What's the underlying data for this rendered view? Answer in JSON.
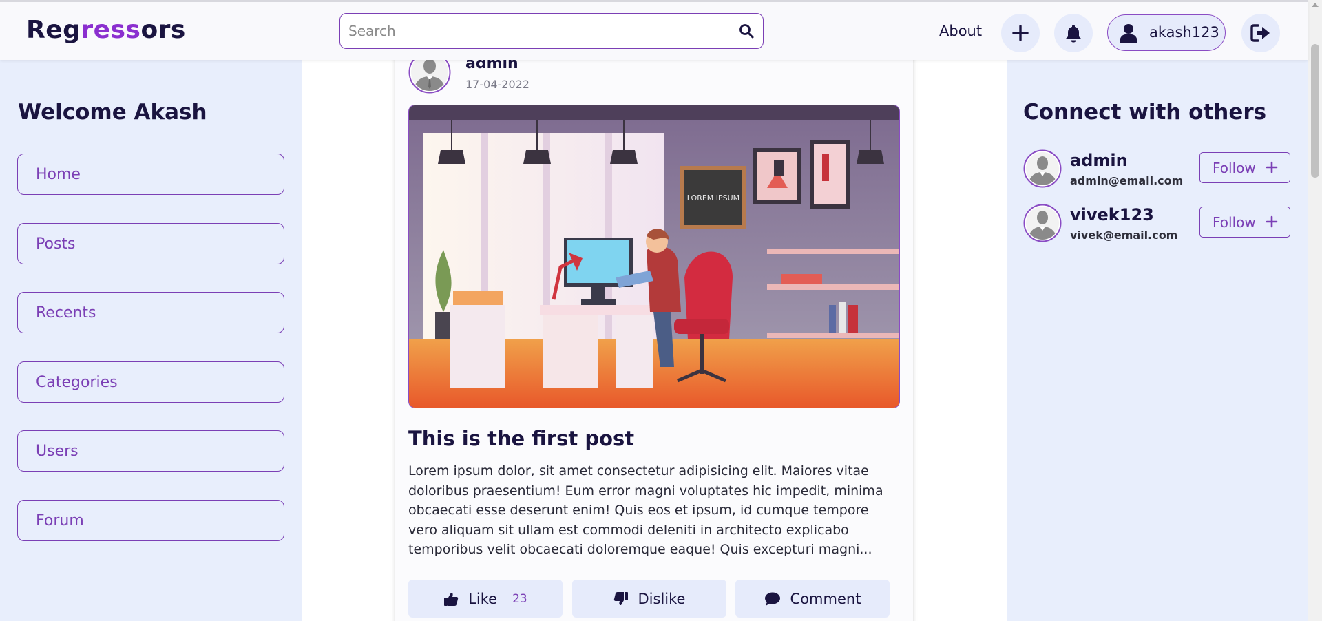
{
  "brand": {
    "part1": "Reg",
    "part2": "ress",
    "part3": "ors",
    "accent_color": "#8b2fcf"
  },
  "search": {
    "placeholder": "Search",
    "value": ""
  },
  "nav": {
    "about_label": "About",
    "add_icon": "plus-icon",
    "notification_icon": "bell-icon",
    "username": "akash123",
    "logout_icon": "sign-out-icon"
  },
  "sidebar": {
    "welcome": "Welcome Akash",
    "items": [
      {
        "label": "Home"
      },
      {
        "label": "Posts"
      },
      {
        "label": "Recents"
      },
      {
        "label": "Categories"
      },
      {
        "label": "Users"
      },
      {
        "label": "Forum"
      }
    ]
  },
  "post": {
    "author": "admin",
    "date": "17-04-2022",
    "title": "This is the first post",
    "body_lines": [
      "Lorem ipsum dolor, sit amet consectetur adipisicing elit. Maiores vitae",
      "doloribus praesentium! Eum error magni voluptates hic impedit, minima",
      "obcaecati esse deserunt enim! Quis eos et ipsum, id cumque tempore",
      "vero aliquam sit ullam est commodi deleniti in architecto explicabo",
      "temporibus velit obcaecati doloremque eaque! Quis excepturi magni..."
    ],
    "image_text": "LOREM IPSUM",
    "actions": {
      "like_label": "Like",
      "like_count": "23",
      "dislike_label": "Dislike",
      "comment_label": "Comment"
    }
  },
  "connect": {
    "title": "Connect with others",
    "follow_label": "Follow",
    "users": [
      {
        "name": "admin",
        "email": "admin@email.com"
      },
      {
        "name": "vivek123",
        "email": "vivek@email.com"
      }
    ]
  },
  "colors": {
    "primary": "#7b3fb5",
    "sidebar_bg": "#e8eefc",
    "text_dark": "#1a1440"
  }
}
